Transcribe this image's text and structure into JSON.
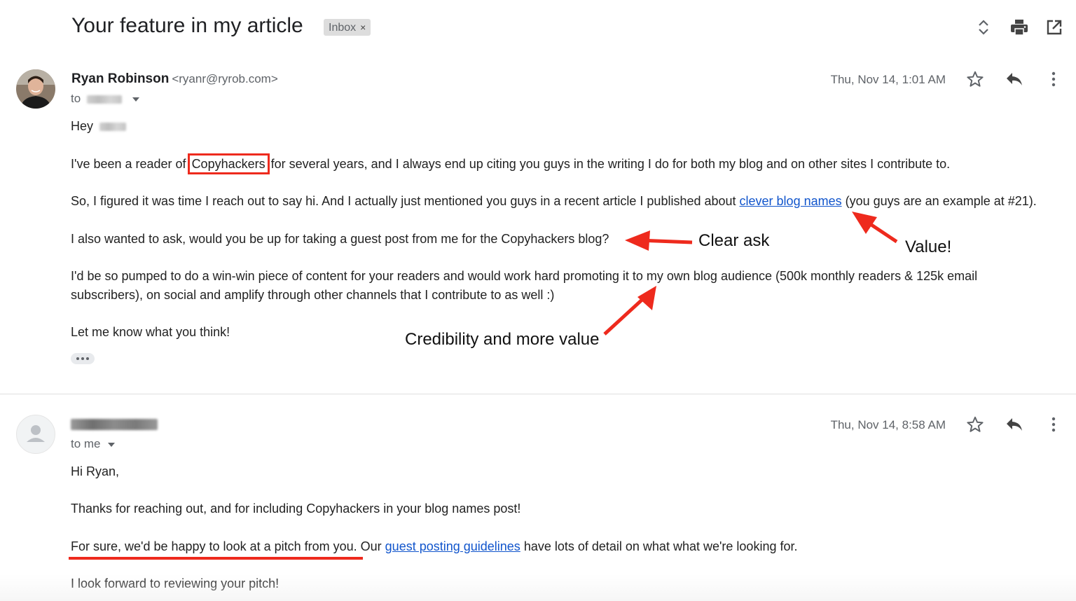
{
  "thread": {
    "subject": "Your feature in my article",
    "label": "Inbox",
    "label_close": "×"
  },
  "toolbar_icons": [
    "expand-collapse-icon",
    "print-icon",
    "open-new-window-icon"
  ],
  "message1": {
    "sender_name": "Ryan Robinson",
    "sender_email": "<ryanr@ryrob.com>",
    "to_prefix": "to",
    "date": "Thu, Nov 14, 1:01 AM",
    "greeting": "Hey",
    "p1_before": "I've been a reader of ",
    "p1_highlight": "Copyhackers",
    "p1_after": " for several years, and I always end up citing you guys in the writing I do for both my blog and on other sites I contribute to.",
    "p2_before": "So, I figured it was time I reach out to say hi. And I actually just mentioned you guys in a recent article I published about ",
    "p2_link": "clever blog names",
    "p2_after": " (you guys are an example at #21).",
    "p3": "I also wanted to ask, would you be up for taking a guest post from me for the Copyhackers blog?",
    "p4_line1": "I'd be so pumped to do a win-win piece of content for your readers and would work hard promoting it to my own blog audience (500k monthly readers & 125k email",
    "p4_line2": "subscribers), on social and amplify through other channels that I contribute to as well :)",
    "p5": "Let me know what you think!"
  },
  "annotations": {
    "clear_ask": "Clear ask",
    "value": "Value!",
    "credibility": "Credibility and more value",
    "arrow_color": "#ee2a1d"
  },
  "message2": {
    "to_label": "to me",
    "date": "Thu, Nov 14, 8:58 AM",
    "greeting": "Hi Ryan,",
    "p1": "Thanks for reaching out, and for including Copyhackers in your blog names post!",
    "p2_underlined": "For sure, we'd be happy to look at a pitch from you.",
    "p2_mid": " Our ",
    "p2_link": "guest posting guidelines",
    "p2_after": " have lots of detail on what what we're looking for.",
    "p3": "I look forward to reviewing your pitch!"
  }
}
